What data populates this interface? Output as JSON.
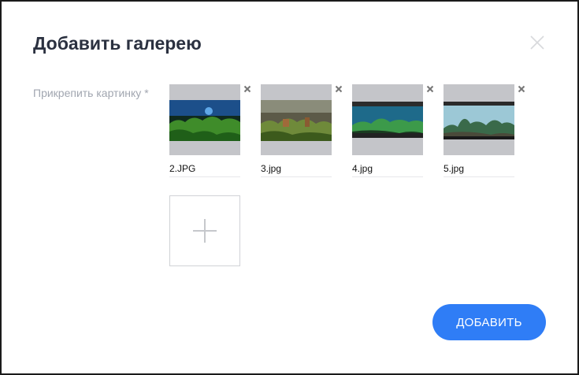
{
  "dialog": {
    "title": "Добавить галерею",
    "close_icon": "close-icon"
  },
  "attach": {
    "label": "Прикрепить картинку *"
  },
  "images": [
    {
      "filename": "2.JPG",
      "remove_icon": "remove-icon"
    },
    {
      "filename": "3.jpg",
      "remove_icon": "remove-icon"
    },
    {
      "filename": "4.jpg",
      "remove_icon": "remove-icon"
    },
    {
      "filename": "5.jpg",
      "remove_icon": "remove-icon"
    }
  ],
  "add_tile": {
    "icon": "plus-icon"
  },
  "submit": {
    "label": "ДОБАВИТЬ"
  },
  "colors": {
    "accent": "#2f7df6",
    "title": "#2b3140",
    "label": "#a1a6b0",
    "thumb_bg": "#c4c5c9"
  }
}
